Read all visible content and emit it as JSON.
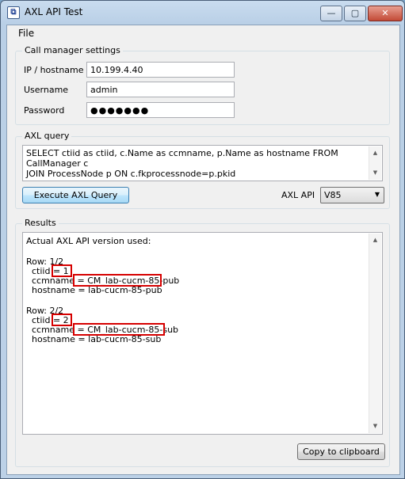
{
  "window": {
    "title": "AXL API Test",
    "app_icon": "app-icon",
    "controls": {
      "minimize": "—",
      "maximize": "▢",
      "close": "✕"
    }
  },
  "menu": {
    "file": "File"
  },
  "settings": {
    "group_label": "Call manager settings",
    "ip_label": "IP / hostname",
    "ip_value": "10.199.4.40",
    "username_label": "Username",
    "username_value": "admin",
    "password_label": "Password",
    "password_value": "●●●●●●●"
  },
  "query": {
    "group_label": "AXL query",
    "text_line1": "SELECT ctiid as ctiid, c.Name as ccmname, p.Name as hostname FROM CallManager c",
    "text_line2": "JOIN ProcessNode p ON c.fkprocessnode=p.pkid",
    "execute_label": "Execute AXL Query",
    "api_label": "AXL API",
    "api_value": "V85"
  },
  "results": {
    "group_label": "Results",
    "lines": [
      "Actual AXL API version used:",
      "",
      "Row: 1/2",
      "  ctiid = 1",
      "  ccmname = CM_lab-cucm-85-pub",
      "  hostname = lab-cucm-85-pub",
      "",
      "Row: 2/2",
      "  ctiid = 2",
      "  ccmname = CM_lab-cucm-85-sub",
      "  hostname = lab-cucm-85-sub"
    ],
    "copy_label": "Copy to clipboard"
  },
  "colors": {
    "highlight": "#d60000",
    "titlebar": "#c9dcef"
  }
}
